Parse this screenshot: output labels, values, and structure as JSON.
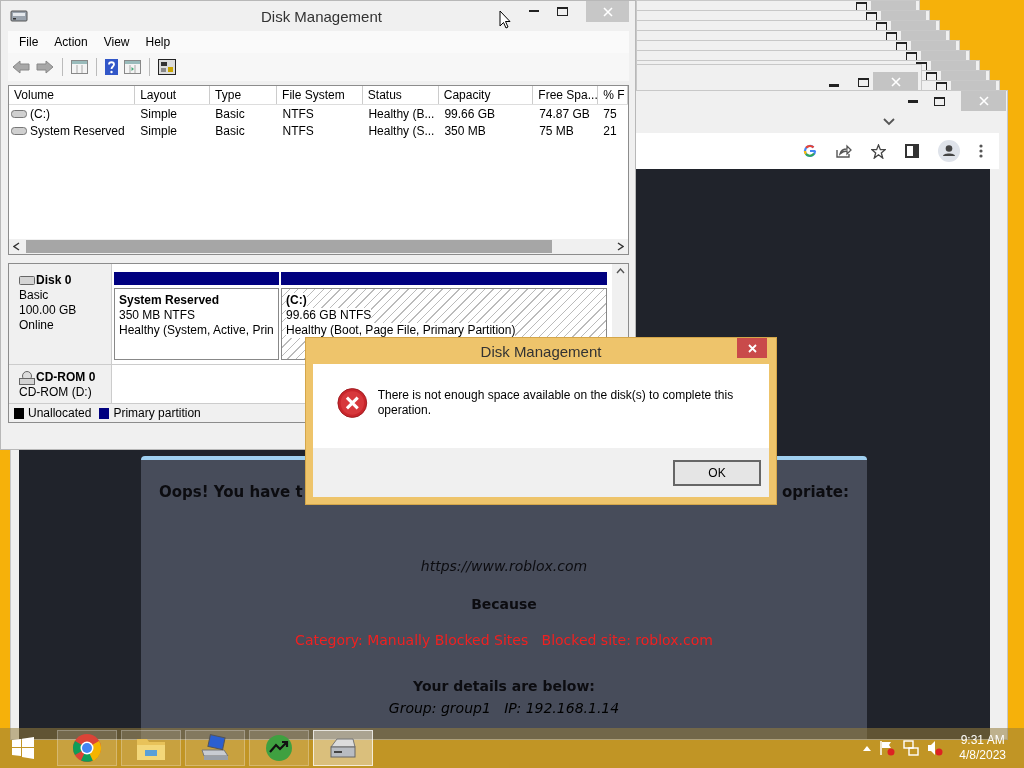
{
  "disk_management": {
    "title": "Disk Management",
    "menu": [
      "File",
      "Action",
      "View",
      "Help"
    ],
    "columns": [
      "Volume",
      "Layout",
      "Type",
      "File System",
      "Status",
      "Capacity",
      "Free Spa...",
      "% F"
    ],
    "volumes": [
      [
        "(C:)",
        "Simple",
        "Basic",
        "NTFS",
        "Healthy (B...",
        "99.66 GB",
        "74.87 GB",
        "75"
      ],
      [
        "System Reserved",
        "Simple",
        "Basic",
        "NTFS",
        "Healthy (S...",
        "350 MB",
        "75 MB",
        "21"
      ]
    ],
    "disks": [
      {
        "kind": "disk",
        "name": "Disk 0",
        "lines": [
          "Basic",
          "100.00 GB",
          "Online"
        ],
        "partitions": [
          {
            "name": "System Reserved",
            "size": "350 MB NTFS",
            "status": "Healthy (System, Active, Prin",
            "selected": false
          },
          {
            "name": "(C:)",
            "size": "99.66 GB NTFS",
            "status": "Healthy (Boot, Page File, Primary Partition)",
            "selected": true
          }
        ]
      },
      {
        "kind": "cdrom",
        "name": "CD-ROM 0",
        "lines": [
          "CD-ROM (D:)"
        ]
      }
    ],
    "legend": [
      {
        "label": "Unallocated",
        "color": "#000000"
      },
      {
        "label": "Primary partition",
        "color": "#00007f"
      }
    ]
  },
  "dialog": {
    "title": "Disk Management",
    "message": "There is not enough space available on the disk(s) to complete this operation.",
    "buttons": [
      "OK"
    ]
  },
  "blocked_page": {
    "heading_start": "Oops! You have t",
    "heading_end": "opriate:",
    "url": "https://www.roblox.com",
    "because": "Because",
    "reason": "Category: Manually Blocked Sites   Blocked site: roblox.com",
    "details": "Your details are below:",
    "group": "Group: group1   IP: 192.168.1.14"
  },
  "taskbar": {
    "apps": [
      {
        "kind": "chrome",
        "selected": false
      },
      {
        "kind": "explorer",
        "selected": false
      },
      {
        "kind": "computer",
        "selected": false
      },
      {
        "kind": "stocks",
        "selected": false
      },
      {
        "kind": "disk",
        "selected": true
      }
    ],
    "time": "9:31 AM",
    "date": "4/8/2023"
  }
}
